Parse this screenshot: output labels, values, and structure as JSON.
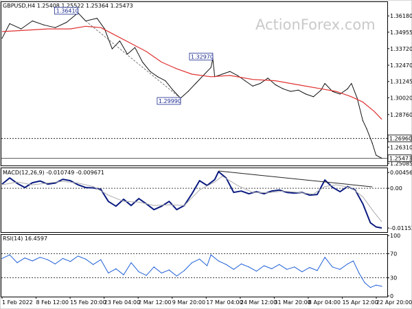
{
  "chart_data": [
    {
      "type": "line",
      "panel": "price",
      "title": "GBPUSD,H4  1.25408  1.25522  1.25364  1.25473",
      "watermark": "ActionForex.com",
      "ylim": [
        1.2498,
        1.3655
      ],
      "yticks": [
        "1.36180",
        "1.34955",
        "1.33720",
        "1.32470",
        "1.31245",
        "1.30020",
        "1.28760",
        "1.26310",
        "1.25085"
      ],
      "xticks": [
        "1 Feb 2022",
        "8 Feb 12:00",
        "15 Feb 20:00",
        "23 Feb 04:00",
        "2 Mar 12:00",
        "9 Mar 20:00",
        "17 Mar 04:00",
        "24 Mar 12:00",
        "31 Mar 20:00",
        "8 Apr 04:00",
        "15 Apr 12:00",
        "22 Apr 20:00"
      ],
      "annotations": [
        {
          "label": "1.36410",
          "value": 1.3641,
          "t": 0.2
        },
        {
          "label": "1.32970",
          "value": 1.3297,
          "t": 0.555
        },
        {
          "label": "1.29990",
          "value": 1.2999,
          "t": 0.47
        }
      ],
      "levels": [
        {
          "label": "1.26960",
          "value": 1.2696,
          "style": "dashed"
        },
        {
          "label": "1.25473",
          "value": 1.25473,
          "style": "solid",
          "current": true
        }
      ],
      "series": [
        {
          "role": "price",
          "color": "#111111",
          "points": [
            [
              0,
              1.345
            ],
            [
              0.02,
              1.356
            ],
            [
              0.05,
              1.352
            ],
            [
              0.08,
              1.358
            ],
            [
              0.11,
              1.355
            ],
            [
              0.14,
              1.353
            ],
            [
              0.17,
              1.357
            ],
            [
              0.2,
              1.3641
            ],
            [
              0.22,
              1.358
            ],
            [
              0.25,
              1.36
            ],
            [
              0.27,
              1.352
            ],
            [
              0.29,
              1.337
            ],
            [
              0.31,
              1.343
            ],
            [
              0.33,
              1.333
            ],
            [
              0.35,
              1.338
            ],
            [
              0.37,
              1.327
            ],
            [
              0.39,
              1.32
            ],
            [
              0.41,
              1.316
            ],
            [
              0.43,
              1.313
            ],
            [
              0.45,
              1.306
            ],
            [
              0.47,
              1.2999
            ],
            [
              0.49,
              1.305
            ],
            [
              0.51,
              1.311
            ],
            [
              0.53,
              1.317
            ],
            [
              0.55,
              1.323
            ],
            [
              0.555,
              1.3297
            ],
            [
              0.56,
              1.316
            ],
            [
              0.58,
              1.318
            ],
            [
              0.6,
              1.32
            ],
            [
              0.62,
              1.317
            ],
            [
              0.64,
              1.313
            ],
            [
              0.66,
              1.309
            ],
            [
              0.68,
              1.311
            ],
            [
              0.7,
              1.315
            ],
            [
              0.72,
              1.31
            ],
            [
              0.74,
              1.307
            ],
            [
              0.76,
              1.305
            ],
            [
              0.78,
              1.306
            ],
            [
              0.8,
              1.303
            ],
            [
              0.82,
              1.301
            ],
            [
              0.84,
              1.306
            ],
            [
              0.85,
              1.311
            ],
            [
              0.87,
              1.305
            ],
            [
              0.89,
              1.303
            ],
            [
              0.91,
              1.307
            ],
            [
              0.92,
              1.311
            ],
            [
              0.935,
              1.3
            ],
            [
              0.95,
              1.283
            ],
            [
              0.96,
              1.277
            ],
            [
              0.975,
              1.266
            ],
            [
              0.985,
              1.257
            ],
            [
              1.0,
              1.2547
            ]
          ]
        },
        {
          "role": "moving-average",
          "color": "#e03030",
          "points": [
            [
              0,
              1.35
            ],
            [
              0.06,
              1.351
            ],
            [
              0.12,
              1.352
            ],
            [
              0.18,
              1.352
            ],
            [
              0.22,
              1.354
            ],
            [
              0.26,
              1.353
            ],
            [
              0.3,
              1.347
            ],
            [
              0.34,
              1.341
            ],
            [
              0.38,
              1.335
            ],
            [
              0.42,
              1.327
            ],
            [
              0.46,
              1.322
            ],
            [
              0.5,
              1.318
            ],
            [
              0.55,
              1.316
            ],
            [
              0.6,
              1.317
            ],
            [
              0.66,
              1.314
            ],
            [
              0.72,
              1.313
            ],
            [
              0.78,
              1.31
            ],
            [
              0.84,
              1.307
            ],
            [
              0.88,
              1.305
            ],
            [
              0.92,
              1.301
            ],
            [
              0.95,
              1.297
            ],
            [
              0.98,
              1.29
            ],
            [
              1.0,
              1.284
            ]
          ]
        },
        {
          "role": "trend-arrow",
          "color": "#777777",
          "style": "dashed",
          "points": [
            [
              0.22,
              1.358
            ],
            [
              0.47,
              1.2999
            ]
          ]
        }
      ]
    },
    {
      "type": "line",
      "panel": "macd",
      "title": "MACD(12,26,9) -0.010749 -0.009671",
      "ylim": [
        -0.0125,
        0.0052
      ],
      "yticks": [
        "0.00456",
        "0.00",
        "-0.011529"
      ],
      "levels": [
        {
          "label": "0.00",
          "value": 0.0,
          "style": "dashed"
        }
      ],
      "series": [
        {
          "role": "macd",
          "color": "#0a1a80",
          "points": [
            [
              0,
              0.0012
            ],
            [
              0.02,
              0.003
            ],
            [
              0.04,
              0.0014
            ],
            [
              0.06,
              0.0002
            ],
            [
              0.08,
              0.0016
            ],
            [
              0.1,
              0.0021
            ],
            [
              0.12,
              0.0012
            ],
            [
              0.14,
              0.0015
            ],
            [
              0.16,
              0.0026
            ],
            [
              0.18,
              0.0022
            ],
            [
              0.2,
              0.001
            ],
            [
              0.22,
              0.0002
            ],
            [
              0.24,
              0.0001
            ],
            [
              0.26,
              -0.0003
            ],
            [
              0.28,
              -0.0038
            ],
            [
              0.3,
              -0.0052
            ],
            [
              0.32,
              -0.0032
            ],
            [
              0.34,
              -0.005
            ],
            [
              0.36,
              -0.003
            ],
            [
              0.38,
              -0.0045
            ],
            [
              0.4,
              -0.0062
            ],
            [
              0.42,
              -0.0052
            ],
            [
              0.44,
              -0.0038
            ],
            [
              0.46,
              -0.0062
            ],
            [
              0.48,
              -0.005
            ],
            [
              0.5,
              -0.0016
            ],
            [
              0.52,
              0.0022
            ],
            [
              0.54,
              0.0008
            ],
            [
              0.56,
              0.0025
            ],
            [
              0.57,
              0.0048
            ],
            [
              0.59,
              0.003
            ],
            [
              0.61,
              -0.0012
            ],
            [
              0.63,
              -0.0008
            ],
            [
              0.65,
              -0.0016
            ],
            [
              0.67,
              -0.001
            ],
            [
              0.69,
              -0.0016
            ],
            [
              0.71,
              -0.0008
            ],
            [
              0.73,
              -0.0005
            ],
            [
              0.75,
              -0.0012
            ],
            [
              0.77,
              -0.0014
            ],
            [
              0.79,
              -0.0012
            ],
            [
              0.81,
              -0.002
            ],
            [
              0.83,
              -0.0018
            ],
            [
              0.85,
              0.0024
            ],
            [
              0.87,
              0.0003
            ],
            [
              0.89,
              -0.001
            ],
            [
              0.91,
              0.0005
            ],
            [
              0.93,
              -0.0005
            ],
            [
              0.95,
              -0.0045
            ],
            [
              0.97,
              -0.01
            ],
            [
              0.985,
              -0.0112
            ],
            [
              1.0,
              -0.0115
            ]
          ]
        },
        {
          "role": "signal",
          "color": "#aaaaaa",
          "points": [
            [
              0,
              0.001
            ],
            [
              0.04,
              0.0018
            ],
            [
              0.08,
              0.001
            ],
            [
              0.12,
              0.0015
            ],
            [
              0.16,
              0.002
            ],
            [
              0.2,
              0.0015
            ],
            [
              0.24,
              0.0005
            ],
            [
              0.28,
              -0.002
            ],
            [
              0.32,
              -0.0038
            ],
            [
              0.36,
              -0.004
            ],
            [
              0.4,
              -0.005
            ],
            [
              0.44,
              -0.0048
            ],
            [
              0.48,
              -0.005
            ],
            [
              0.52,
              -0.0005
            ],
            [
              0.56,
              0.0018
            ],
            [
              0.58,
              0.0035
            ],
            [
              0.62,
              0.0008
            ],
            [
              0.66,
              -0.0012
            ],
            [
              0.7,
              -0.0013
            ],
            [
              0.74,
              -0.0008
            ],
            [
              0.78,
              -0.0012
            ],
            [
              0.82,
              -0.0017
            ],
            [
              0.85,
              0.0005
            ],
            [
              0.88,
              0.001
            ],
            [
              0.92,
              0.0001
            ],
            [
              0.95,
              -0.0025
            ],
            [
              0.98,
              -0.007
            ],
            [
              1.0,
              -0.0097
            ]
          ]
        },
        {
          "role": "divergence-line",
          "color": "#222222",
          "points": [
            [
              0.57,
              0.005
            ],
            [
              0.975,
              0.0004
            ]
          ]
        }
      ]
    },
    {
      "type": "line",
      "panel": "rsi",
      "title": "RSI(14) 16.4597",
      "ylim": [
        0,
        100
      ],
      "yticks": [
        "100",
        "70",
        "30",
        "0"
      ],
      "levels": [
        {
          "label": "70",
          "value": 70,
          "style": "dashed"
        },
        {
          "label": "30",
          "value": 30,
          "style": "dashed"
        }
      ],
      "series": [
        {
          "role": "rsi",
          "color": "#1f5fd6",
          "points": [
            [
              0,
              62
            ],
            [
              0.02,
              68
            ],
            [
              0.04,
              55
            ],
            [
              0.06,
              63
            ],
            [
              0.08,
              58
            ],
            [
              0.1,
              64
            ],
            [
              0.12,
              60
            ],
            [
              0.14,
              53
            ],
            [
              0.16,
              62
            ],
            [
              0.18,
              57
            ],
            [
              0.2,
              66
            ],
            [
              0.22,
              61
            ],
            [
              0.24,
              52
            ],
            [
              0.26,
              60
            ],
            [
              0.28,
              38
            ],
            [
              0.3,
              45
            ],
            [
              0.32,
              35
            ],
            [
              0.34,
              55
            ],
            [
              0.36,
              40
            ],
            [
              0.38,
              34
            ],
            [
              0.4,
              48
            ],
            [
              0.42,
              38
            ],
            [
              0.44,
              43
            ],
            [
              0.46,
              33
            ],
            [
              0.48,
              42
            ],
            [
              0.5,
              55
            ],
            [
              0.52,
              61
            ],
            [
              0.54,
              50
            ],
            [
              0.55,
              68
            ],
            [
              0.57,
              58
            ],
            [
              0.59,
              52
            ],
            [
              0.61,
              44
            ],
            [
              0.63,
              53
            ],
            [
              0.65,
              48
            ],
            [
              0.67,
              41
            ],
            [
              0.69,
              50
            ],
            [
              0.71,
              45
            ],
            [
              0.73,
              52
            ],
            [
              0.75,
              44
            ],
            [
              0.77,
              48
            ],
            [
              0.79,
              40
            ],
            [
              0.81,
              47
            ],
            [
              0.83,
              42
            ],
            [
              0.85,
              64
            ],
            [
              0.87,
              48
            ],
            [
              0.89,
              44
            ],
            [
              0.91,
              53
            ],
            [
              0.925,
              58
            ],
            [
              0.94,
              38
            ],
            [
              0.955,
              22
            ],
            [
              0.97,
              14
            ],
            [
              0.985,
              18
            ],
            [
              1.0,
              16
            ]
          ]
        }
      ]
    }
  ]
}
